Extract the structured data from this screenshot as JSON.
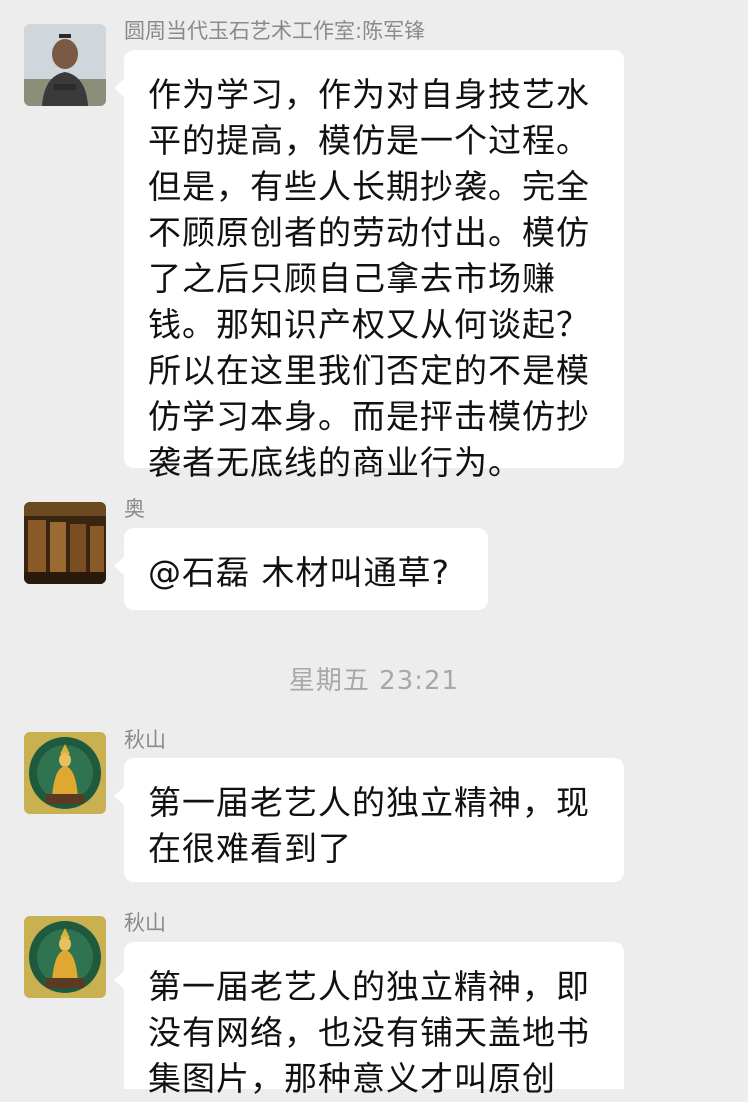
{
  "chat": {
    "messages": [
      {
        "sender": "圆周当代玉石艺术工作室:陈军锋",
        "avatar_icon": "man-portrait-avatar",
        "text": "作为学习，作为对自身技艺水平的提高，模仿是一个过程。但是，有些人长期抄袭。完全不顾原创者的劳动付出。模仿了之后只顾自己拿去市场赚钱。那知识产权又从何谈起？所以在这里我们否定的不是模仿学习本身。而是抨击模仿抄袭者无底线的商业行为。"
      },
      {
        "sender": "奥",
        "avatar_icon": "library-shelves-avatar",
        "text": "@石磊 木材叫通草?"
      },
      {
        "sender": "秋山",
        "avatar_icon": "golden-figure-avatar",
        "text": "第一届老艺人的独立精神，现在很难看到了"
      },
      {
        "sender": "秋山",
        "avatar_icon": "golden-figure-avatar",
        "text": "第一届老艺人的独立精神，即没有网络，也没有铺天盖地书集图片，那种意义才叫原创"
      }
    ],
    "timestamp": "星期五 23:21"
  },
  "colors": {
    "background": "#ededed",
    "bubble": "#ffffff",
    "sender_text": "#8a8a8a",
    "timestamp_text": "#a8a8a8",
    "message_text": "#111111"
  }
}
